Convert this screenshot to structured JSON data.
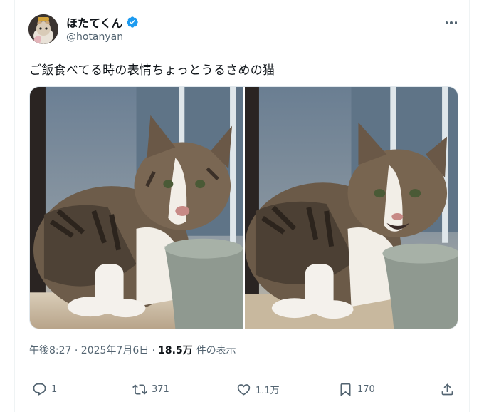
{
  "user": {
    "display_name": "ほたてくん",
    "handle": "@hotanyan",
    "verified": true
  },
  "tweet": {
    "text": "ご飯食べてる時の表情ちょっとうるさめの猫"
  },
  "meta": {
    "timestamp": "午後8:27 · 2025年7月6日 · ",
    "views": "18.5万",
    "views_label": "件の表示"
  },
  "actions": {
    "reply_count": "1",
    "retweet_count": "371",
    "like_count": "1.1万",
    "bookmark_count": "170"
  },
  "colors": {
    "text": "#0f1419",
    "secondary": "#536471",
    "verified": "#1d9bf0"
  },
  "icons": [
    "verified-badge-icon",
    "more-icon",
    "reply-icon",
    "retweet-icon",
    "like-icon",
    "bookmark-icon",
    "share-icon"
  ]
}
